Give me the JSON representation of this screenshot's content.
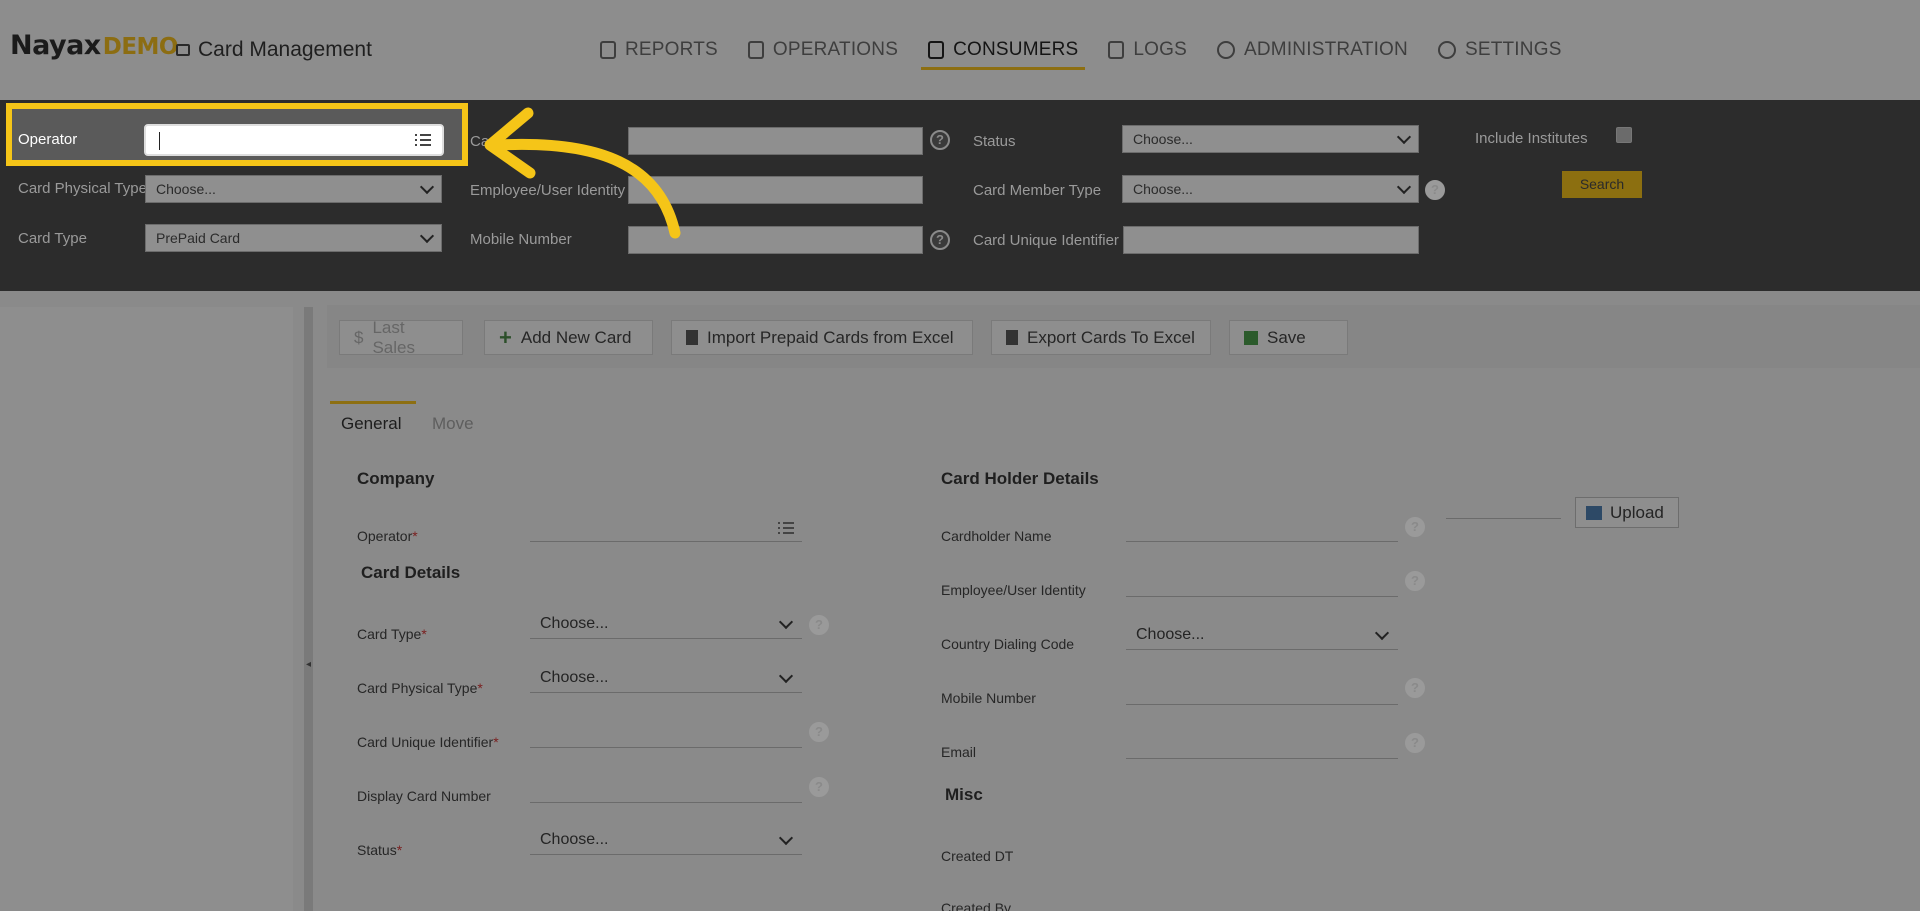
{
  "header": {
    "logo": "Nayax",
    "logo_suffix": "DEMO",
    "app_title": "Card Management",
    "nav": [
      {
        "label": "REPORTS",
        "icon": "report-icon"
      },
      {
        "label": "OPERATIONS",
        "icon": "device-icon"
      },
      {
        "label": "CONSUMERS",
        "icon": "consumer-icon",
        "active": true
      },
      {
        "label": "LOGS",
        "icon": "calendar-icon"
      },
      {
        "label": "ADMINISTRATION",
        "icon": "gauge-icon"
      },
      {
        "label": "SETTINGS",
        "icon": "gear-icon"
      }
    ]
  },
  "filters": {
    "operator_label": "Operator",
    "operator_value": "",
    "card_partial_label": "Ca",
    "status_label": "Status",
    "status_value": "Choose...",
    "include_institutes_label": "Include Institutes",
    "card_physical_type_label": "Card Physical Type",
    "card_physical_type_value": "Choose...",
    "employee_identity_label": "Employee/User Identity",
    "card_member_type_label": "Card Member Type",
    "card_member_type_value": "Choose...",
    "search_label": "Search",
    "card_type_label": "Card Type",
    "card_type_value": "PrePaid Card",
    "mobile_number_label": "Mobile Number",
    "card_unique_identifier_label": "Card Unique Identifier"
  },
  "toolbar": {
    "last_sales": "Last Sales",
    "last_sales_icon": "$",
    "add_new_card": "Add New Card",
    "import_excel": "Import Prepaid Cards from Excel",
    "export_excel": "Export Cards To Excel",
    "save": "Save"
  },
  "tabs": {
    "general": "General",
    "move": "Move"
  },
  "form": {
    "company_title": "Company",
    "operator_label": "Operator",
    "card_details_title": "Card Details",
    "card_type_label": "Card Type",
    "card_type_value": "Choose...",
    "card_physical_type_label": "Card Physical Type",
    "card_physical_type_value": "Choose...",
    "card_unique_identifier_label": "Card Unique Identifier",
    "display_card_number_label": "Display Card Number",
    "status_label": "Status",
    "status_value": "Choose...",
    "required_mark": "*",
    "card_holder_title": "Card Holder Details",
    "cardholder_name_label": "Cardholder Name",
    "employee_identity_label": "Employee/User Identity",
    "country_code_label": "Country Dialing Code",
    "country_code_value": "Choose...",
    "mobile_number_label": "Mobile Number",
    "email_label": "Email",
    "misc_title": "Misc",
    "created_dt_label": "Created DT",
    "created_by_label": "Created By",
    "upload_label": "Upload",
    "help_glyph": "?"
  },
  "colors": {
    "highlight": "#f5c518",
    "accent": "#8d6f12",
    "filter_bg": "#2c2c2c"
  }
}
